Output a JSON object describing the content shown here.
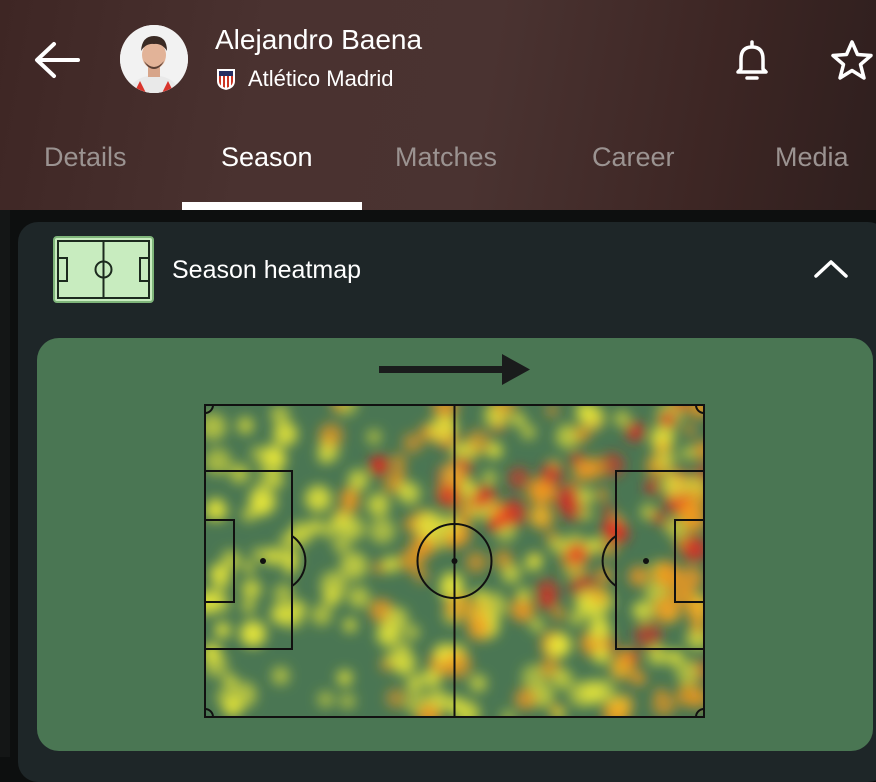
{
  "header": {
    "player_name": "Alejandro Baena",
    "team_name": "Atlético Madrid"
  },
  "icons": {
    "back": "back-arrow-icon",
    "notifications": "bell-icon",
    "favorite": "star-icon",
    "heatmap": "pitch-icon",
    "collapse": "chevron-up-icon",
    "direction": "attack-direction-arrow"
  },
  "tabs": [
    {
      "label": "Details",
      "active": false
    },
    {
      "label": "Season",
      "active": true
    },
    {
      "label": "Matches",
      "active": false
    },
    {
      "label": "Career",
      "active": false
    },
    {
      "label": "Media",
      "active": false
    }
  ],
  "heatmap_card": {
    "title": "Season heatmap",
    "expanded": true
  },
  "colors": {
    "header_bg": "#4a3230",
    "card_bg": "#1e2628",
    "pitch_bg": "#4a7653",
    "icon_pitch_bg": "#c8ecbf",
    "heat_low": "#e6e63a",
    "heat_mid": "#f39a1e",
    "heat_high": "#e22b20"
  }
}
